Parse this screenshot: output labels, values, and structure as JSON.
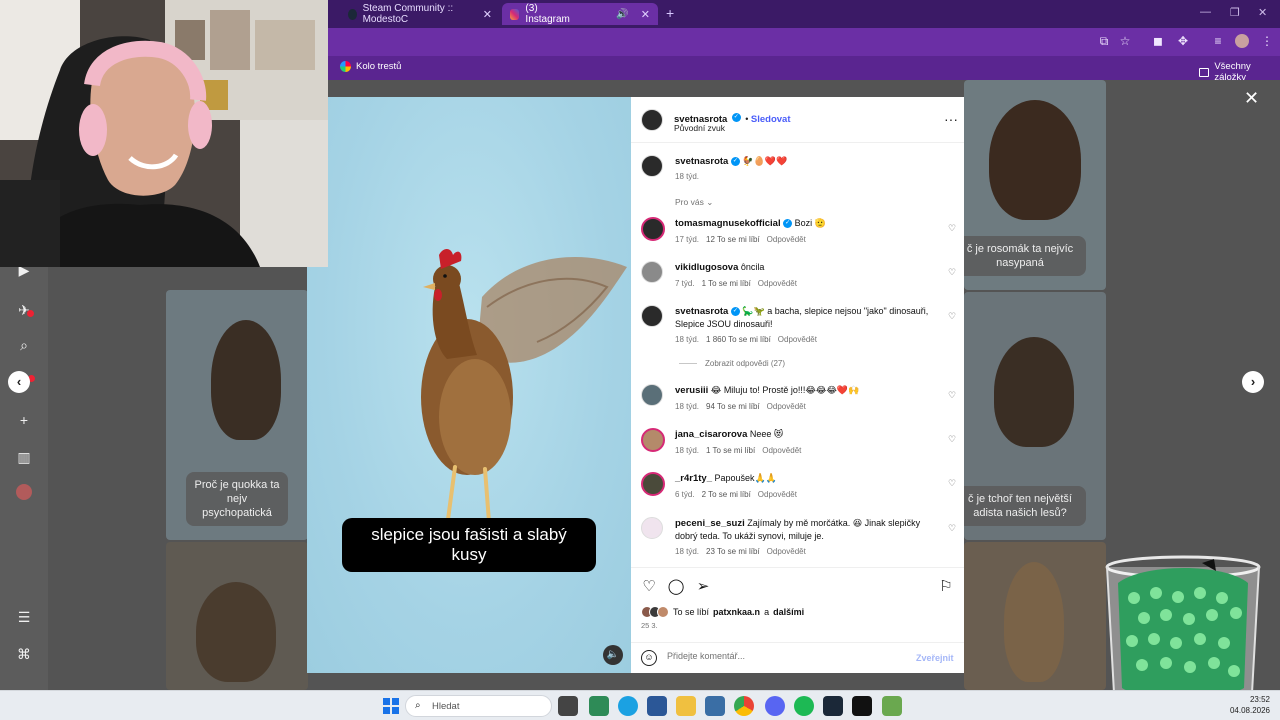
{
  "browser": {
    "tabs": [
      {
        "label": "Steam Community :: ModestoC"
      },
      {
        "label": "(3) Instagram",
        "active": true
      }
    ],
    "bookmarks": {
      "item": "Kolo trestů",
      "all_bookmarks": "Všechny záložky"
    }
  },
  "background_cards": {
    "quokka_caption": "Proč je quokka ta nejv psychopatická",
    "wolverine_caption": "č je rosomák ta nejvíc nasypaná",
    "ferret_caption": "č je tchoř ten největší adista našich lesů?"
  },
  "reel": {
    "subtitle": "slepice jsou fašisti a slabý kusy"
  },
  "post": {
    "author": "svetnasrota",
    "follow_label": "Sledovat",
    "audio": "Původní zvuk",
    "caption_user": "svetnasrota",
    "caption_text": "🐓🥚❤️❤️",
    "caption_time": "18 týd.",
    "filter_label": "Pro vás",
    "likes_text": "To se líbí",
    "likes_user": "patxnkaa.n",
    "likes_and": "a",
    "likes_others": "dalšími",
    "date": "25 3.",
    "comment_placeholder": "Přidejte komentář...",
    "publish_label": "Zveřejnit"
  },
  "comments": [
    {
      "user": "tomasmagnusekofficial",
      "verified": true,
      "text": "Bozi 🫡",
      "time": "17 týd.",
      "likes": "12 To se mi líbí",
      "reply": "Odpovědět",
      "avatar_color": "#1f2a44",
      "ring": true
    },
    {
      "user": "vikidlugosova",
      "verified": false,
      "text": "ôncila",
      "time": "7 týd.",
      "likes": "1 To se mi líbí",
      "reply": "Odpovědět",
      "avatar_color": "#8a8a8a",
      "ring": false
    },
    {
      "user": "svetnasrota",
      "verified": true,
      "text": "🦕🦖 a bacha, slepice nejsou \"jako\" dinosauři, Slepice JSOU dinosauři!",
      "time": "18 týd.",
      "likes": "1 860 To se mi líbí",
      "reply": "Odpovědět",
      "avatar_color": "#2a2a2a",
      "ring": false,
      "view_replies": "Zobrazit odpovědi (27)"
    },
    {
      "user": "verusiii",
      "verified": false,
      "text": "😂 Miluju to! Prostě jo!!!😂😂😂❤️🙌",
      "time": "18 týd.",
      "likes": "94 To se mi líbí",
      "reply": "Odpovědět",
      "avatar_color": "#5a6f78",
      "ring": false
    },
    {
      "user": "jana_cisarorova",
      "verified": false,
      "text": "Neee 😻",
      "time": "18 týd.",
      "likes": "1 To se mi líbí",
      "reply": "Odpovědět",
      "avatar_color": "#b48a6a",
      "ring": true
    },
    {
      "user": "_r4r1ty_",
      "verified": false,
      "text": "Papoušek🙏🙏",
      "time": "6 týd.",
      "likes": "2 To se mi líbí",
      "reply": "Odpovědět",
      "avatar_color": "#4a4a3a",
      "ring": true
    },
    {
      "user": "peceni_se_suzi",
      "verified": false,
      "text": "Zajímaly by mě morčátka. 😆 Jinak slepičky dobrý teda. To ukáži synovi, miluje je.",
      "time": "18 týd.",
      "likes": "23 To se mi líbí",
      "reply": "Odpovědět",
      "avatar_color": "#f0e4ee",
      "ring": false
    }
  ],
  "taskbar": {
    "search_placeholder": "Hledat",
    "time": "23:52",
    "date": "04.08.2026"
  },
  "colors": {
    "tabbar": "#3b1a66",
    "toolbar": "#6b2fa5",
    "instagram_blue": "#0095f6",
    "follow": "#4a5df9"
  }
}
